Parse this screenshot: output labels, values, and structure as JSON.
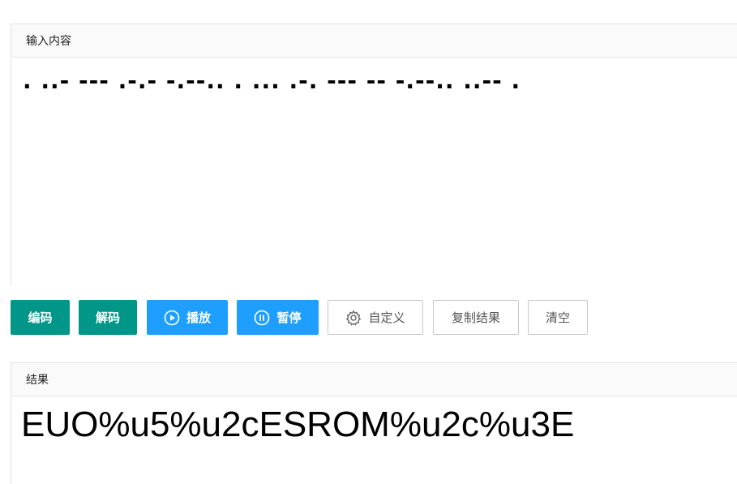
{
  "input": {
    "label": "输入内容",
    "value": ". ..- --- .-.- -.--.. . ... .-. --- -- -.--.. ..-- ."
  },
  "toolbar": {
    "encode": "编码",
    "decode": "解码",
    "play": "播放",
    "pause": "暂停",
    "custom": "自定义",
    "copy_result": "复制结果",
    "clear": "清空"
  },
  "result": {
    "label": "结果",
    "value": "EUO%u5%u2cESROM%u2c%u3E"
  },
  "colors": {
    "green": "#009688",
    "blue": "#1e9fff",
    "border": "#c9c9c9"
  },
  "icons": {
    "play": "play-circle-icon",
    "pause": "pause-circle-icon",
    "custom": "gear-icon"
  }
}
